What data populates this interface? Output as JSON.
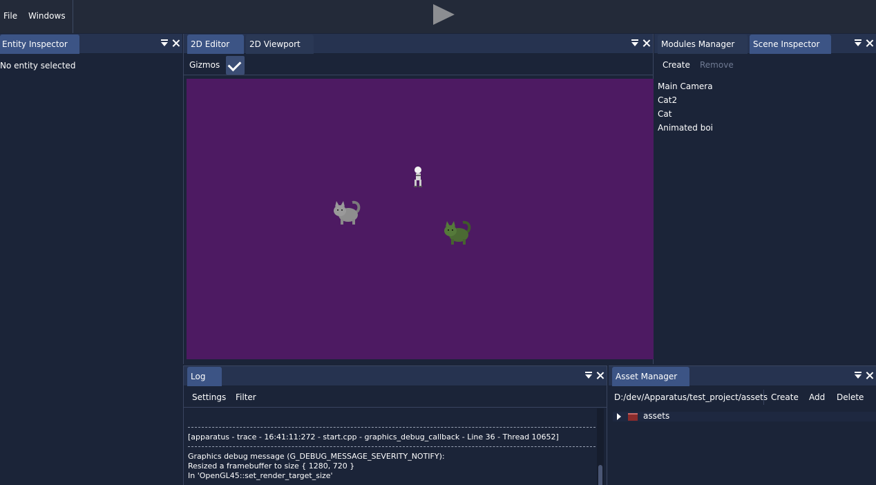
{
  "menubar": {
    "file_label": "File",
    "windows_label": "Windows"
  },
  "entity_inspector": {
    "tab_label": "Entity Inspector",
    "empty_text": "No entity selected"
  },
  "editor": {
    "tabs": [
      {
        "label": "2D Editor"
      },
      {
        "label": "2D Viewport"
      }
    ],
    "gizmos_label": "Gizmos",
    "gizmos_checked": true,
    "viewport_color": "#4d1a62"
  },
  "right_panel": {
    "tabs": [
      {
        "label": "Modules Manager"
      },
      {
        "label": "Scene Inspector"
      }
    ],
    "create_label": "Create",
    "remove_label": "Remove",
    "entities": [
      {
        "name": "Main Camera"
      },
      {
        "name": "Cat2"
      },
      {
        "name": "Cat"
      },
      {
        "name": "Animated boi"
      }
    ]
  },
  "log": {
    "tab_label": "Log",
    "settings_label": "Settings",
    "filter_label": "Filter",
    "lines": [
      {
        "text": "[apparatus - trace - 16:41:11:272 - start.cpp - graphics_debug_callback - Line 36 - Thread 10652]"
      },
      {
        "text": "Graphics debug message (G_DEBUG_MESSAGE_SEVERITY_NOTIFY):"
      },
      {
        "text": "Resized a framebuffer to size { 1280, 720 }"
      },
      {
        "text": "In 'OpenGL45::set_render_target_size'"
      }
    ]
  },
  "asset_manager": {
    "tab_label": "Asset Manager",
    "path": "D:/dev/Apparatus/test_project/assets",
    "create_label": "Create",
    "add_label": "Add",
    "delete_label": "Delete",
    "tree_items": [
      {
        "label": "assets"
      }
    ]
  }
}
